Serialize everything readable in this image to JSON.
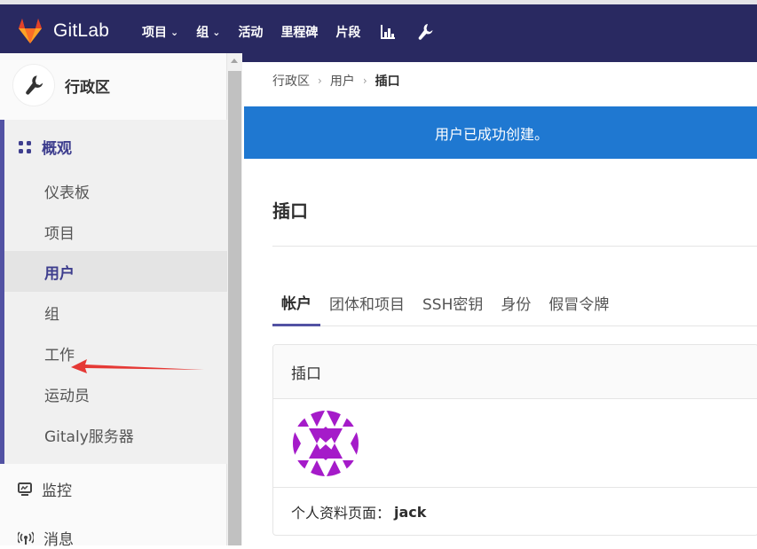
{
  "app": {
    "name": "GitLab"
  },
  "topnav": {
    "items": [
      {
        "label": "项目",
        "dropdown": true
      },
      {
        "label": "组",
        "dropdown": true
      },
      {
        "label": "活动",
        "dropdown": false
      },
      {
        "label": "里程碑",
        "dropdown": false
      },
      {
        "label": "片段",
        "dropdown": false
      }
    ],
    "icons": [
      "chart-icon",
      "wrench-icon"
    ]
  },
  "sidebar": {
    "context_title": "行政区",
    "group": {
      "label": "概观",
      "items": [
        {
          "label": "仪表板",
          "active": false
        },
        {
          "label": "项目",
          "active": false
        },
        {
          "label": "用户",
          "active": true
        },
        {
          "label": "组",
          "active": false
        },
        {
          "label": "工作",
          "active": false
        },
        {
          "label": "运动员",
          "active": false
        },
        {
          "label": "Gitaly服务器",
          "active": false
        }
      ]
    },
    "lower_items": [
      {
        "label": "监控",
        "icon": "monitor-icon"
      },
      {
        "label": "消息",
        "icon": "broadcast-icon"
      }
    ]
  },
  "breadcrumb": [
    "行政区",
    "用户",
    "插口"
  ],
  "flash": {
    "message": "用户已成功创建。",
    "color": "#1f78d1"
  },
  "page": {
    "title": "插口"
  },
  "tabs": [
    {
      "label": "帐户",
      "active": true
    },
    {
      "label": "团体和项目",
      "active": false
    },
    {
      "label": "SSH密钥",
      "active": false
    },
    {
      "label": "身份",
      "active": false
    },
    {
      "label": "假冒令牌",
      "active": false
    }
  ],
  "card": {
    "title": "插口",
    "profile_label": "个人资料页面：",
    "profile_value": "jack"
  },
  "colors": {
    "topbar": "#292961",
    "accent": "#5252a3",
    "flash": "#1f78d1",
    "annotation_arrow": "#e53935"
  }
}
